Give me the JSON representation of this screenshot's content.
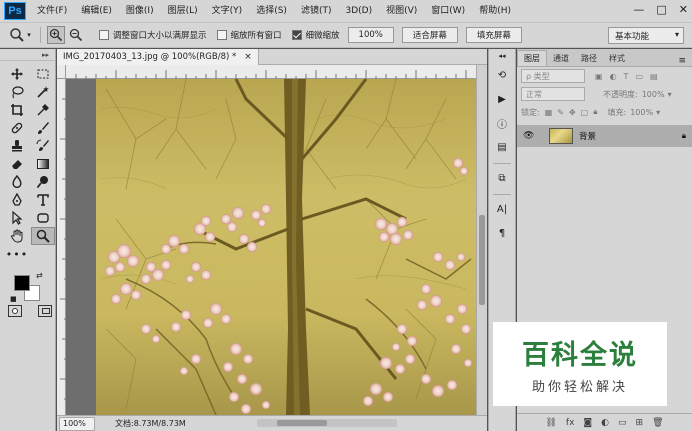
{
  "app": {
    "logo": "Ps",
    "menus": [
      "文件(F)",
      "编辑(E)",
      "图像(I)",
      "图层(L)",
      "文字(Y)",
      "选择(S)",
      "滤镜(T)",
      "3D(D)",
      "视图(V)",
      "窗口(W)",
      "帮助(H)"
    ],
    "window_controls": [
      "—",
      "□",
      "✕"
    ]
  },
  "options": {
    "resize_windows": "调整窗口大小以满屏显示",
    "zoom_all": "缩放所有窗口",
    "scrubby_zoom": "细微缩放",
    "zoom_value": "100%",
    "fit_screen": "适合屏幕",
    "fill_screen": "填充屏幕",
    "workspace": "基本功能"
  },
  "document": {
    "tab_title": "IMG_20170403_13.jpg @ 100%(RGB/8) *",
    "zoom": "100%",
    "doc_info": "文档:8.73M/8.73M"
  },
  "layers_panel": {
    "tabs": [
      "图层",
      "通道",
      "路径",
      "样式"
    ],
    "kind": "ρ 类型",
    "blend_mode": "正常",
    "opacity_label": "不透明度:",
    "opacity": "100%",
    "lock_label": "锁定:",
    "fill_label": "填充:",
    "fill": "100%",
    "layer_name": "背景"
  },
  "watermark": {
    "title": "百科全说",
    "subtitle": "助你轻松解决"
  }
}
